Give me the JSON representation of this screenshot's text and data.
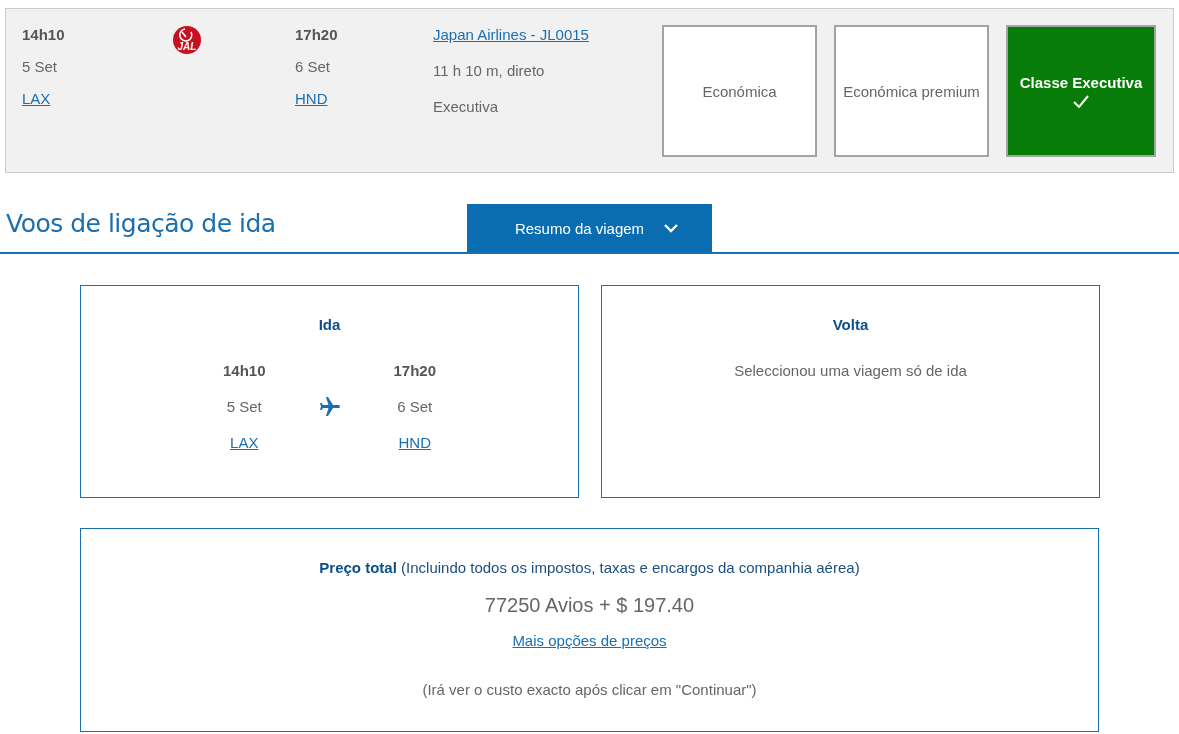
{
  "flight": {
    "departure": {
      "time": "14h10",
      "date": "5 Set",
      "airport": "LAX"
    },
    "logo_text": "JAL",
    "arrival": {
      "time": "17h20",
      "date": "6 Set",
      "airport": "HND"
    },
    "flight_link": "Japan Airlines - JL0015",
    "duration": "11 h 10 m, direto",
    "cabin": "Executiva",
    "cabin_options": [
      {
        "label": "Económica",
        "selected": false
      },
      {
        "label": "Económica premium",
        "selected": false
      },
      {
        "label": "Classe Executiva",
        "selected": true
      }
    ]
  },
  "section_title": "Voos de ligação de ida",
  "summary_tab": {
    "label": "Resumo da viagem",
    "expanded": false
  },
  "outbound": {
    "title": "Ida",
    "departure": {
      "time": "14h10",
      "date": "5 Set",
      "airport": "LAX"
    },
    "arrival": {
      "time": "17h20",
      "date": "6 Set",
      "airport": "HND"
    }
  },
  "return": {
    "title": "Volta",
    "message": "Seleccionou uma viagem só de ida"
  },
  "price": {
    "title": "**Preço total** (Incluindo todos os impostos, taxas e encargos da companhia aérea)",
    "amount": "77250 Avios + $ 197.40",
    "more_link": "Mais opções de preços",
    "note": "(Irá ver o custo exacto após clicar em \"Continuar\")"
  }
}
